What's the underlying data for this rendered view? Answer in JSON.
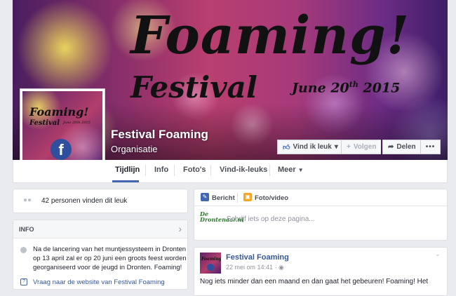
{
  "cover": {
    "title": "Foaming!",
    "subtitle": "Festival",
    "date_prefix": "June 20",
    "date_sup": "th",
    "date_year": " 2015"
  },
  "profile": {
    "title": "Foaming!",
    "subtitle": "Festival",
    "date": "June 20th 2015",
    "fb_letter": "f"
  },
  "page": {
    "name": "Festival Foaming",
    "category": "Organisatie"
  },
  "actions": {
    "like": "Vind ik leuk",
    "like_caret": "▾",
    "follow": "Volgen",
    "share": "Delen",
    "more": "•••"
  },
  "tabs": {
    "timeline": "Tijdlijn",
    "info": "Info",
    "photos": "Foto's",
    "likes": "Vind-ik-leuks",
    "more": "Meer"
  },
  "likes_card": {
    "text": "42 personen vinden dit leuk"
  },
  "info_card": {
    "title": "INFO",
    "description": "Na de lancering van het muntjessysteem in Dronten op 13 april zal er op 20 juni een groots feest worden georganiseerd voor de jeugd in Dronten. Foaming!",
    "website_link": "Vraag naar de website van Festival Foaming"
  },
  "composer": {
    "tab_post": "Bericht",
    "tab_photo": "Foto/video",
    "placeholder": "Schrijf iets op deze pagina...",
    "avatar_text": "De Drontenaar.nl"
  },
  "post": {
    "author": "Festival Foaming",
    "time": "22 mei om 14:41 · ",
    "text": "Nog iets minder dan een maand en dan gaat het gebeuren! Foaming! Het"
  },
  "colors": {
    "accent": "#4267b2",
    "link": "#365899",
    "page_bg": "#e9ebee"
  },
  "icons": {
    "like_button": "thumbs-up-icon",
    "follow_button": "plus-icon",
    "share_button": "share-arrow-icon",
    "likes_card": "people-icon",
    "info_item": "info-icon",
    "website": "external-link-icon",
    "post_tab": "pencil-icon",
    "photo_tab": "photo-icon",
    "privacy": "globe-icon"
  }
}
